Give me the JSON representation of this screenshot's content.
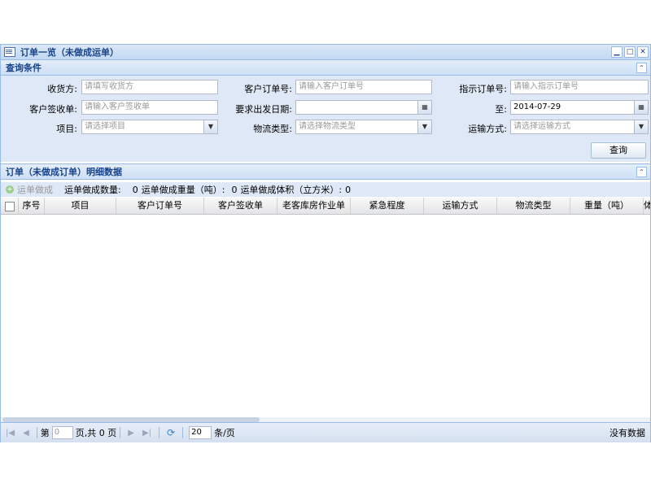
{
  "window": {
    "title": "订单一览（未做成运单）"
  },
  "query": {
    "section_title": "查询条件",
    "consignee": {
      "label": "收货方:",
      "placeholder": "请填写收货方"
    },
    "customer_order_no": {
      "label": "客户订单号:",
      "placeholder": "请输入客户订单号"
    },
    "instruction_order_no": {
      "label": "指示订单号:",
      "placeholder": "请输入指示订单号"
    },
    "customer_receipt": {
      "label": "客户签收单:",
      "placeholder": "请输入客户签收单"
    },
    "departure_date": {
      "label": "要求出发日期:",
      "value": ""
    },
    "to_date": {
      "label": "至:",
      "value": "2014-07-29"
    },
    "project": {
      "label": "项目:",
      "placeholder": "请选择项目"
    },
    "logistics_type": {
      "label": "物流类型:",
      "placeholder": "请选择物流类型"
    },
    "transport_mode": {
      "label": "运输方式:",
      "placeholder": "请选择运输方式"
    },
    "search_button": "查询"
  },
  "details": {
    "section_title": "订单（未做成订单）明细数据",
    "toolbar": {
      "add_label": "运单做成",
      "count_label": "运单做成数量:",
      "count_value": "0",
      "weight_label": "运单做成重量（吨）:",
      "weight_value": "0",
      "volume_label": "运单做成体积（立方米）:",
      "volume_value": "0"
    },
    "columns": [
      "序号",
      "项目",
      "客户订单号",
      "客户签收单",
      "老客库房作业单",
      "紧急程度",
      "运输方式",
      "物流类型",
      "重量（吨）",
      "体"
    ]
  },
  "pager": {
    "page_prefix": "第",
    "page_value": "0",
    "page_suffix": "页,共 0 页",
    "page_size": "20",
    "per_page": "条/页",
    "info": "没有数据"
  },
  "colors": {
    "border": "#99bbe8",
    "header_text": "#15428b",
    "panel_bg": "#dfe8f6"
  }
}
